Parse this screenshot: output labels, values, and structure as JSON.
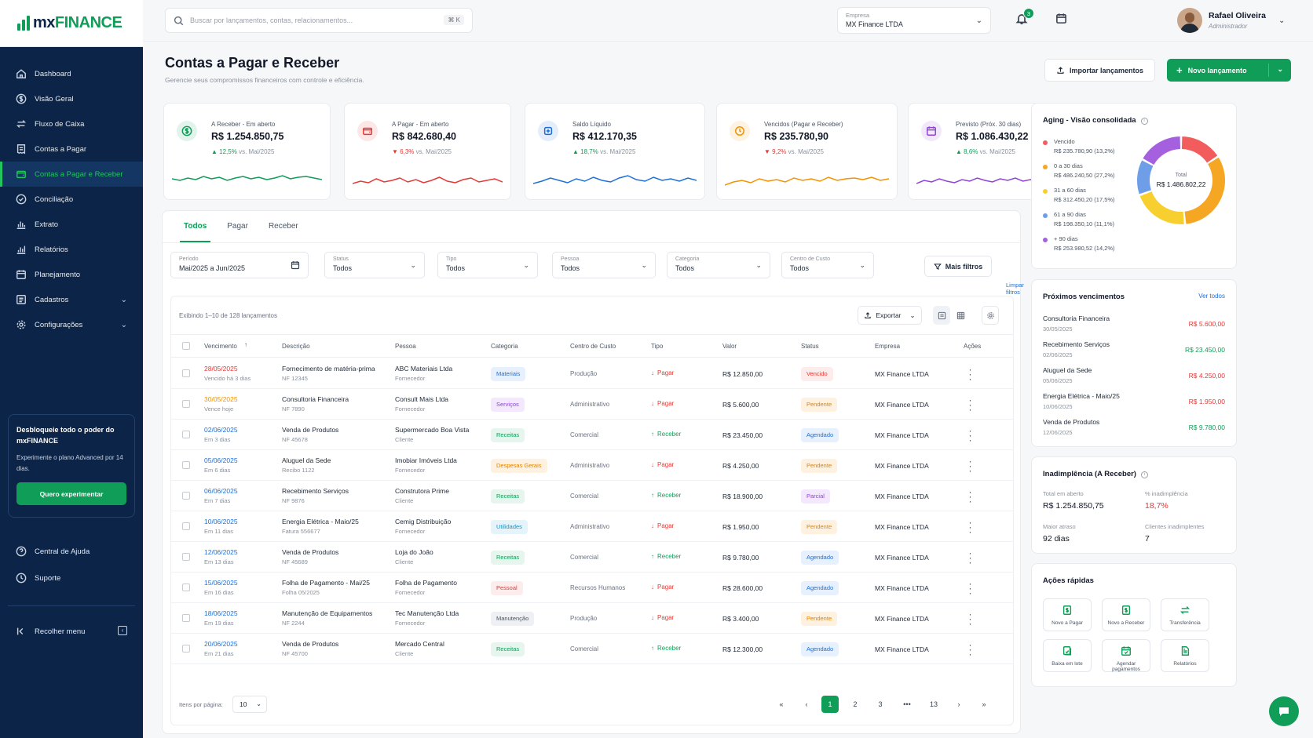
{
  "brand": {
    "logo_left": "mx",
    "logo_right": "FINANCE"
  },
  "sidebar": {
    "items": [
      {
        "label": "Dashboard",
        "icon": "home-icon"
      },
      {
        "label": "Visão Geral",
        "icon": "dollar-circle-icon"
      },
      {
        "label": "Fluxo de Caixa",
        "icon": "transfer-icon"
      },
      {
        "label": "Contas a Pagar",
        "icon": "receipt-icon"
      },
      {
        "label": "Contas a Pagar e Receber",
        "icon": "wallet-icon"
      },
      {
        "label": "Conciliação",
        "icon": "check-circle-icon"
      },
      {
        "label": "Extrato",
        "icon": "bar-chart-icon"
      },
      {
        "label": "Relatórios",
        "icon": "report-icon"
      },
      {
        "label": "Planejamento",
        "icon": "calendar-icon"
      },
      {
        "label": "Cadastros",
        "icon": "list-icon"
      },
      {
        "label": "Configurações",
        "icon": "gear-icon"
      }
    ],
    "promo": {
      "title": "Desbloqueie todo o poder do mxFINANCE",
      "text": "Experimente o plano Advanced por 14 dias.",
      "button": "Quero experimentar"
    },
    "help": "Central de Ajuda",
    "support": "Suporte",
    "collapse": "Recolher menu"
  },
  "topbar": {
    "search_placeholder": "Buscar por lançamentos, contas, relacionamentos...",
    "shortcut": "⌘ K",
    "company_label": "Empresa",
    "company_value": "MX Finance LTDA",
    "notifications": "3",
    "user_name": "Rafael Oliveira",
    "user_role": "Administrador"
  },
  "page": {
    "title": "Contas a Pagar e Receber",
    "subtitle": "Gerencie seus compromissos financeiros com controle e eficiência.",
    "import_button": "Importar lançamentos",
    "new_button": "Novo lançamento"
  },
  "kpis": [
    {
      "label": "A Receber - Em aberto",
      "value": "R$ 1.254.850,75",
      "delta": "12,5%",
      "dir": "up",
      "vs": "vs. Mai/2025",
      "color": "#0f9d58",
      "icon": "dollar-circle-icon"
    },
    {
      "label": "A Pagar - Em aberto",
      "value": "R$ 842.680,40",
      "delta": "6,3%",
      "dir": "down",
      "vs": "vs. Mai/2025",
      "color": "#e53935",
      "icon": "wallet-icon"
    },
    {
      "label": "Saldo Líquido",
      "value": "R$ 412.170,35",
      "delta": "18,7%",
      "dir": "up",
      "vs": "vs. Mai/2025",
      "color": "#1d6fd8",
      "icon": "scale-icon"
    },
    {
      "label": "Vencidos (Pagar e Receber)",
      "value": "R$ 235.780,90",
      "delta": "9,2%",
      "dir": "down",
      "vs": "vs. Mai/2025",
      "color": "#f39200",
      "icon": "clock-icon"
    },
    {
      "label": "Previsto (Próx. 30 dias)",
      "value": "R$ 1.086.430,22",
      "delta": "8,6%",
      "dir": "up",
      "vs": "vs. Mai/2025",
      "color": "#8e44d6",
      "icon": "calendar-icon"
    }
  ],
  "tabs": [
    "Todos",
    "Pagar",
    "Receber"
  ],
  "filters": [
    {
      "label": "Período",
      "value": "Mai/2025 a Jun/2025"
    },
    {
      "label": "Status",
      "value": "Todos"
    },
    {
      "label": "Tipo",
      "value": "Todos"
    },
    {
      "label": "Pessoa",
      "value": "Todos"
    },
    {
      "label": "Categoria",
      "value": "Todos"
    },
    {
      "label": "Centro de Custo",
      "value": "Todos"
    }
  ],
  "more_filters": "Mais filtros",
  "clear_filters": "Limpar filtros",
  "table": {
    "showing": "Exibindo 1–10 de 128 lançamentos",
    "export": "Exportar",
    "headers": [
      "Vencimento",
      "Descrição",
      "Pessoa",
      "Categoria",
      "Centro de Custo",
      "Tipo",
      "Valor",
      "Status",
      "Empresa",
      "Ações"
    ],
    "rows": [
      {
        "date": "28/05/2025",
        "due": "Vencido há 3 dias",
        "desc": "Fornecimento de matéria-prima",
        "doc": "NF 12345",
        "person": "ABC Materiais Ltda",
        "role": "Fornecedor",
        "cat": "Materiais",
        "cc": "Produção",
        "type": "Pagar",
        "value": "R$ 12.850,00",
        "status": "Vencido",
        "company": "MX Finance LTDA"
      },
      {
        "date": "30/05/2025",
        "due": "Vence hoje",
        "desc": "Consultoria Financeira",
        "doc": "NF 7890",
        "person": "Consult Mais Ltda",
        "role": "Fornecedor",
        "cat": "Serviços",
        "cc": "Administrativo",
        "type": "Pagar",
        "value": "R$ 5.600,00",
        "status": "Pendente",
        "company": "MX Finance LTDA"
      },
      {
        "date": "02/06/2025",
        "due": "Em 3 dias",
        "desc": "Venda de Produtos",
        "doc": "NF 45678",
        "person": "Supermercado Boa Vista",
        "role": "Cliente",
        "cat": "Receitas",
        "cc": "Comercial",
        "type": "Receber",
        "value": "R$ 23.450,00",
        "status": "Agendado",
        "company": "MX Finance LTDA"
      },
      {
        "date": "05/06/2025",
        "due": "Em 6 dias",
        "desc": "Aluguel da Sede",
        "doc": "Recibo 1122",
        "person": "Imobiar Imóveis Ltda",
        "role": "Fornecedor",
        "cat": "Despesas Gerais",
        "cc": "Administrativo",
        "type": "Pagar",
        "value": "R$ 4.250,00",
        "status": "Pendente",
        "company": "MX Finance LTDA"
      },
      {
        "date": "06/06/2025",
        "due": "Em 7 dias",
        "desc": "Recebimento Serviços",
        "doc": "NF 9876",
        "person": "Construtora Prime",
        "role": "Cliente",
        "cat": "Receitas",
        "cc": "Comercial",
        "type": "Receber",
        "value": "R$ 18.900,00",
        "status": "Parcial",
        "company": "MX Finance LTDA"
      },
      {
        "date": "10/06/2025",
        "due": "Em 11 dias",
        "desc": "Energia Elétrica - Maio/25",
        "doc": "Fatura 556677",
        "person": "Cemig Distribuição",
        "role": "Fornecedor",
        "cat": "Utilidades",
        "cc": "Administrativo",
        "type": "Pagar",
        "value": "R$ 1.950,00",
        "status": "Pendente",
        "company": "MX Finance LTDA"
      },
      {
        "date": "12/06/2025",
        "due": "Em 13 dias",
        "desc": "Venda de Produtos",
        "doc": "NF 45689",
        "person": "Loja do João",
        "role": "Cliente",
        "cat": "Receitas",
        "cc": "Comercial",
        "type": "Receber",
        "value": "R$ 9.780,00",
        "status": "Agendado",
        "company": "MX Finance LTDA"
      },
      {
        "date": "15/06/2025",
        "due": "Em 16 dias",
        "desc": "Folha de Pagamento - Mai/25",
        "doc": "Folha 05/2025",
        "person": "Folha de Pagamento",
        "role": "Fornecedor",
        "cat": "Pessoal",
        "cc": "Recursos Humanos",
        "type": "Pagar",
        "value": "R$ 28.600,00",
        "status": "Agendado",
        "company": "MX Finance LTDA"
      },
      {
        "date": "18/06/2025",
        "due": "Em 19 dias",
        "desc": "Manutenção de Equipamentos",
        "doc": "NF 2244",
        "person": "Tec Manutenção Ltda",
        "role": "Fornecedor",
        "cat": "Manutenção",
        "cc": "Produção",
        "type": "Pagar",
        "value": "R$ 3.400,00",
        "status": "Pendente",
        "company": "MX Finance LTDA"
      },
      {
        "date": "20/06/2025",
        "due": "Em 21 dias",
        "desc": "Venda de Produtos",
        "doc": "NF 45700",
        "person": "Mercado Central",
        "role": "Cliente",
        "cat": "Receitas",
        "cc": "Comercial",
        "type": "Receber",
        "value": "R$ 12.300,00",
        "status": "Agendado",
        "company": "MX Finance LTDA"
      }
    ],
    "per_page_label": "Itens por página:",
    "per_page": "10",
    "pages": [
      "«",
      "‹",
      "1",
      "2",
      "3",
      "•••",
      "13",
      "›",
      "»"
    ]
  },
  "aging": {
    "title": "Aging - Visão consolidada",
    "total_label": "Total",
    "total": "R$ 1.486.802,22",
    "items": [
      {
        "name": "Vencido",
        "value": "R$ 235.780,90 (13,2%)",
        "color": "#f25c5c",
        "pct": 13.2
      },
      {
        "name": "0 a 30 dias",
        "value": "R$ 486.240,50 (27,2%)",
        "color": "#f5a623",
        "pct": 27.2
      },
      {
        "name": "31 a 60 dias",
        "value": "R$ 312.450,20 (17,5%)",
        "color": "#f7d030",
        "pct": 17.5
      },
      {
        "name": "61 a 90 dias",
        "value": "R$ 198.350,10 (11,1%)",
        "color": "#6f9ee8",
        "pct": 11.1
      },
      {
        "name": "+ 90 dias",
        "value": "R$ 253.980,52 (14,2%)",
        "color": "#a560e0",
        "pct": 14.2
      }
    ]
  },
  "upcoming": {
    "title": "Próximos vencimentos",
    "see_all": "Ver todos",
    "items": [
      {
        "desc": "Consultoria Financeira",
        "date": "30/05/2025",
        "amount": "R$ 5.600,00",
        "kind": "pay"
      },
      {
        "desc": "Recebimento Serviços",
        "date": "02/06/2025",
        "amount": "R$ 23.450,00",
        "kind": "receive"
      },
      {
        "desc": "Aluguel da Sede",
        "date": "05/06/2025",
        "amount": "R$ 4.250,00",
        "kind": "pay"
      },
      {
        "desc": "Energia Elétrica - Maio/25",
        "date": "10/06/2025",
        "amount": "R$ 1.950,00",
        "kind": "pay"
      },
      {
        "desc": "Venda de Produtos",
        "date": "12/06/2025",
        "amount": "R$ 9.780,00",
        "kind": "receive"
      }
    ]
  },
  "default": {
    "title": "Inadimplência (A Receber)",
    "open_label": "Total em aberto",
    "open_value": "R$ 1.254.850,75",
    "pct_label": "% inadimplência",
    "pct_value": "18,7%",
    "delay_label": "Maior atraso",
    "delay_value": "92 dias",
    "clients_label": "Clientes inadimplentes",
    "clients_value": "7"
  },
  "quick": {
    "title": "Ações rápidas",
    "items": [
      "Novo a Pagar",
      "Novo a Receber",
      "Transferência",
      "Baixa em lote",
      "Agendar pagamentos",
      "Relatórios"
    ]
  }
}
